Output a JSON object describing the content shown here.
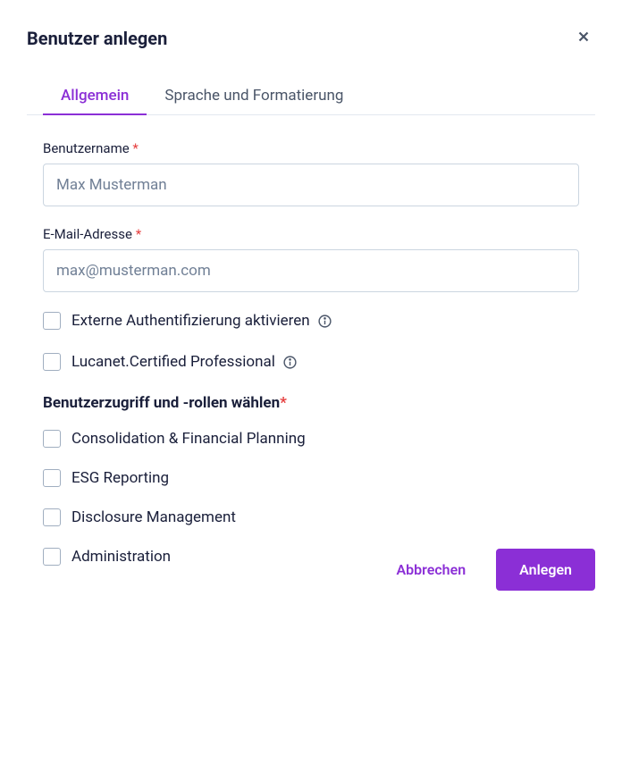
{
  "modal": {
    "title": "Benutzer anlegen",
    "tabs": [
      {
        "label": "Allgemein",
        "active": true
      },
      {
        "label": "Sprache und Formatierung",
        "active": false
      }
    ]
  },
  "form": {
    "username": {
      "label": "Benutzername",
      "placeholder": "Max Musterman"
    },
    "email": {
      "label": "E-Mail-Adresse",
      "placeholder": "max@musterman.com"
    },
    "external_auth": {
      "label": "Externe Authentifizierung aktivieren"
    },
    "certified": {
      "label": "Lucanet.Certified Professional"
    },
    "roles_section": {
      "title": "Benutzerzugriff und -rollen wählen"
    },
    "roles": [
      {
        "label": "Consolidation & Financial Planning"
      },
      {
        "label": "ESG Reporting"
      },
      {
        "label": "Disclosure Management"
      },
      {
        "label": "Administration"
      }
    ]
  },
  "footer": {
    "cancel": "Abbrechen",
    "submit": "Anlegen"
  }
}
